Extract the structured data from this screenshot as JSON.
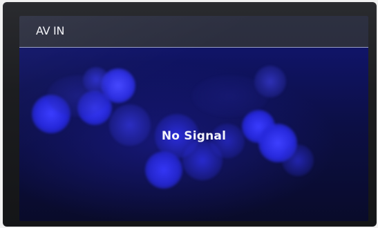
{
  "header": {
    "title": "AV IN"
  },
  "main": {
    "status_message": "No Signal"
  },
  "colors": {
    "title_bar": "#2d3041",
    "screen_background": "#0b0c22",
    "bokeh_blue": "#2a2cf0",
    "text": "#f4f4fa"
  }
}
